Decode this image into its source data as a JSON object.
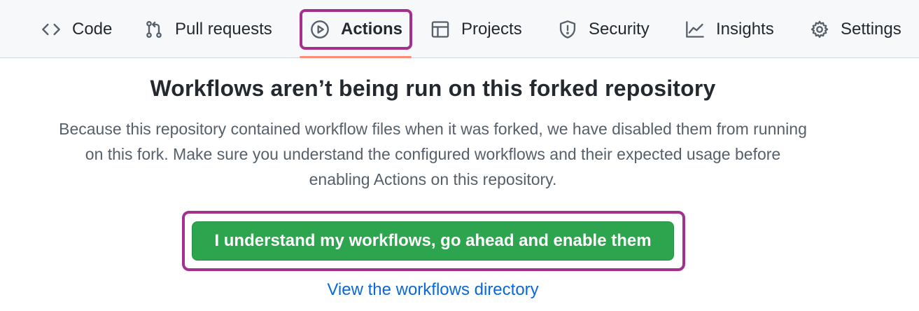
{
  "tabs": [
    {
      "label": "Code",
      "icon": "code-icon"
    },
    {
      "label": "Pull requests",
      "icon": "pull-request-icon"
    },
    {
      "label": "Actions",
      "icon": "play-icon",
      "active": true
    },
    {
      "label": "Projects",
      "icon": "table-icon"
    },
    {
      "label": "Security",
      "icon": "shield-icon"
    },
    {
      "label": "Insights",
      "icon": "graph-icon"
    },
    {
      "label": "Settings",
      "icon": "gear-icon"
    }
  ],
  "main": {
    "title": "Workflows aren’t being run on this forked repository",
    "description_lines": [
      "Because this repository contained workflow files when it was forked, we have disabled them from running",
      "on this fork. Make sure you understand the configured workflows and their expected usage before",
      "enabling Actions on this repository."
    ],
    "enable_button_label": "I understand my workflows, go ahead and enable them",
    "workflows_link_label": "View the workflows directory"
  },
  "colors": {
    "accent_green": "#2da44e",
    "link_blue": "#0969da",
    "highlight_magenta": "#a3308c",
    "active_underline": "#fd8c73"
  }
}
